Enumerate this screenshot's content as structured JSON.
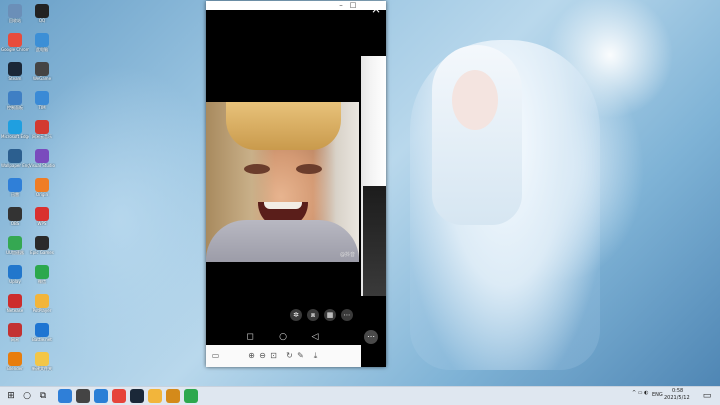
{
  "desktop": {
    "icons": [
      {
        "label": "回收站",
        "color": "#6b8fb8"
      },
      {
        "label": "QQ",
        "color": "#222222"
      },
      {
        "label": "Google Chrome",
        "color": "#e84c3d"
      },
      {
        "label": "此电脑",
        "color": "#3c8fd6"
      },
      {
        "label": "Steam",
        "color": "#1b2838"
      },
      {
        "label": "WeGame",
        "color": "#444444"
      },
      {
        "label": "控制面板",
        "color": "#3f7fc4"
      },
      {
        "label": "TIM",
        "color": "#3a8ad6"
      },
      {
        "label": "Microsoft Edge",
        "color": "#1f9fe0"
      },
      {
        "label": "网易云音乐",
        "color": "#d33a31"
      },
      {
        "label": "Wallpaper Engine",
        "color": "#2c5f8f"
      },
      {
        "label": "Visual Studio",
        "color": "#7a4bbd"
      },
      {
        "label": "迅雷",
        "color": "#2f7fd8"
      },
      {
        "label": "Origin",
        "color": "#ef7d25"
      },
      {
        "label": "OBS",
        "color": "#333333"
      },
      {
        "label": "WPS",
        "color": "#d9302f"
      },
      {
        "label": "UU加速器",
        "color": "#35a852"
      },
      {
        "label": "Epic Games",
        "color": "#2a2a2a"
      },
      {
        "label": "Uplay",
        "color": "#2277cc"
      },
      {
        "label": "微信",
        "color": "#2ca84d"
      },
      {
        "label": "Netease",
        "color": "#cc2d2d"
      },
      {
        "label": "PotPlayer",
        "color": "#f2b53b"
      },
      {
        "label": "网易",
        "color": "#c33232"
      },
      {
        "label": "Battle.net",
        "color": "#1e75d2"
      },
      {
        "label": "Blender",
        "color": "#e87d0d"
      },
      {
        "label": "新建文件夹",
        "color": "#f3c647"
      }
    ]
  },
  "window": {
    "close_icon": "×",
    "watermark": "@抖音",
    "controls": [
      "✲",
      "⧈",
      "▦",
      "⋯"
    ],
    "nav": [
      "◻",
      "○",
      "◁"
    ],
    "more": "⋯",
    "toolbar": [
      "▭",
      "⊕",
      "⊖",
      "⊡",
      "↻",
      "✎",
      "⤓"
    ]
  },
  "taskbar": {
    "tray_lang": "ENG",
    "time": "0:58",
    "date": "2021/5/12",
    "apps": [
      "#2f7fd8",
      "#444",
      "#2a7fd6",
      "#e6443a",
      "#1b2838",
      "#f2b53b",
      "#d48a1a",
      "#2ca84d"
    ]
  }
}
